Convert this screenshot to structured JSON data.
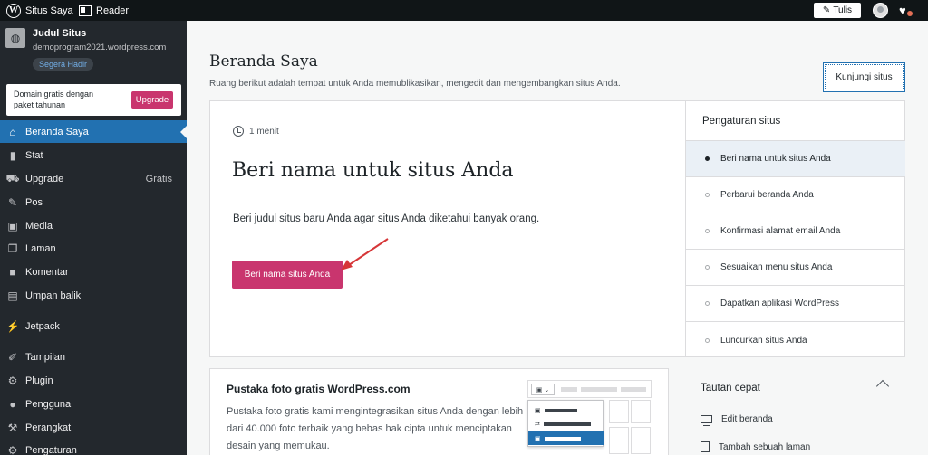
{
  "topbar": {
    "site_label": "Situs Saya",
    "reader_label": "Reader",
    "write_label": "Tulis"
  },
  "sidebar": {
    "site_title": "Judul Situs",
    "site_url": "demoprogram2021.wordpress.com",
    "site_badge": "Segera Hadir",
    "promo_text": "Domain gratis dengan paket tahunan",
    "promo_button": "Upgrade",
    "items": [
      {
        "label": "Beranda Saya",
        "icon": "home-icon"
      },
      {
        "label": "Stat",
        "icon": "stats-icon"
      },
      {
        "label": "Upgrade",
        "icon": "cart-icon",
        "extra": "Gratis"
      },
      {
        "label": "Pos",
        "icon": "pin-icon"
      },
      {
        "label": "Media",
        "icon": "media-icon"
      },
      {
        "label": "Laman",
        "icon": "pages-icon"
      },
      {
        "label": "Komentar",
        "icon": "comment-icon"
      },
      {
        "label": "Umpan balik",
        "icon": "feedback-icon"
      },
      {
        "label": "Jetpack",
        "icon": "jetpack-icon"
      },
      {
        "label": "Tampilan",
        "icon": "brush-icon"
      },
      {
        "label": "Plugin",
        "icon": "plugin-icon"
      },
      {
        "label": "Pengguna",
        "icon": "users-icon"
      },
      {
        "label": "Perangkat",
        "icon": "tools-icon"
      },
      {
        "label": "Pengaturan",
        "icon": "settings-icon"
      }
    ],
    "active_index": 0
  },
  "main": {
    "title": "Beranda Saya",
    "subtitle": "Ruang berikut adalah tempat untuk Anda memublikasikan, mengedit dan mengembangkan situs Anda.",
    "visit_button": "Kunjungi situs",
    "task": {
      "time": "1 menit",
      "title": "Beri nama untuk situs Anda",
      "description": "Beri judul situs baru Anda agar situs Anda diketahui banyak orang.",
      "button": "Beri nama situs Anda"
    },
    "checklist": {
      "heading": "Pengaturan situs",
      "items": [
        "Beri nama untuk situs Anda",
        "Perbarui beranda Anda",
        "Konfirmasi alamat email Anda",
        "Sesuaikan menu situs Anda",
        "Dapatkan aplikasi WordPress",
        "Luncurkan situs Anda"
      ],
      "active_index": 0
    },
    "photo_card": {
      "title": "Pustaka foto gratis WordPress.com",
      "description": "Pustaka foto gratis kami mengintegrasikan situs Anda dengan lebih dari 40.000 foto terbaik yang bebas hak cipta untuk menciptakan desain yang memukau."
    },
    "quick_links": {
      "title": "Tautan cepat",
      "items": [
        "Edit beranda",
        "Tambah sebuah laman"
      ]
    }
  },
  "colors": {
    "topbar": "#101517",
    "sidebar": "#23282d",
    "active_nav": "#2271b1",
    "accent_button": "#c9356e",
    "arrow": "#d63638"
  }
}
